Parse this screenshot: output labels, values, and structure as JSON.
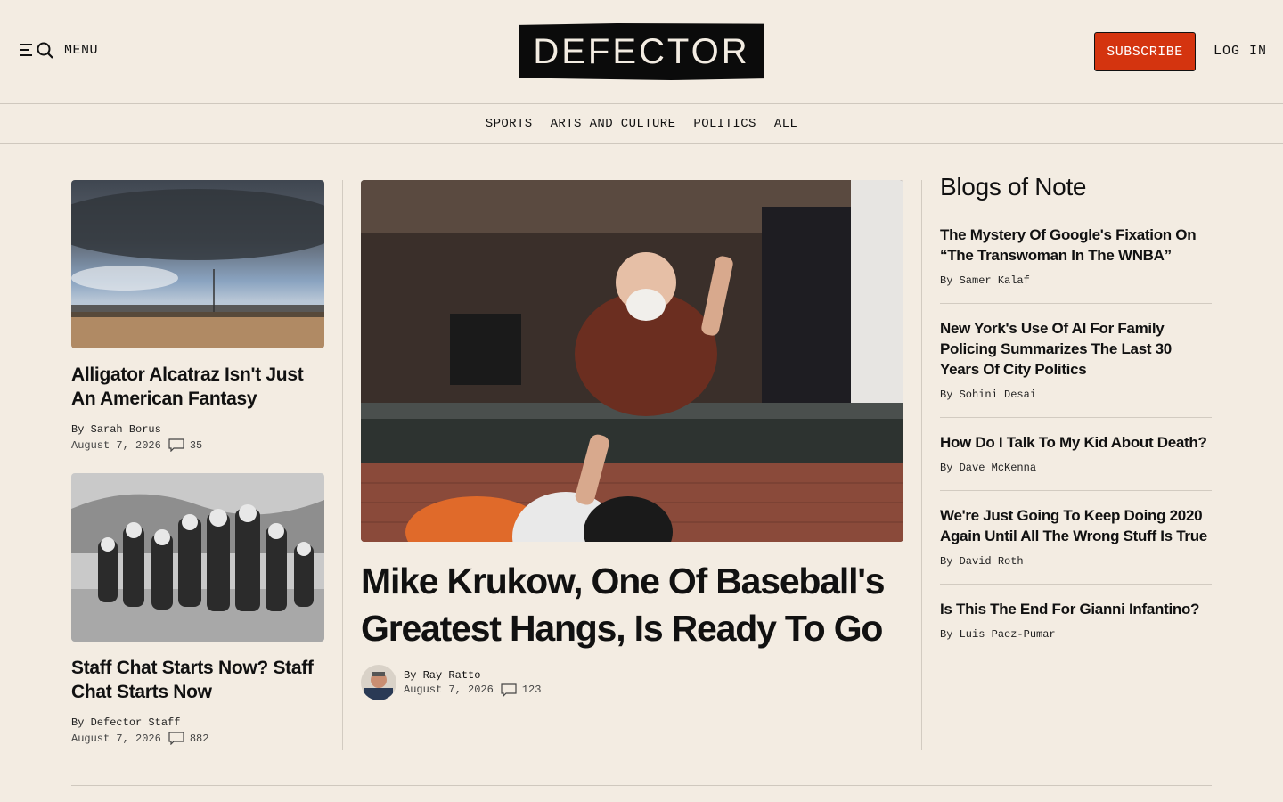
{
  "header": {
    "menu_label": "MENU",
    "logo_text": "DEFECTOR",
    "subscribe_label": "SUBSCRIBE",
    "login_label": "LOG IN"
  },
  "nav": {
    "items": [
      "SPORTS",
      "ARTS AND CULTURE",
      "POLITICS",
      "ALL"
    ]
  },
  "left_articles": [
    {
      "title": "Alligator Alcatraz Isn't Just An American Fantasy",
      "author": "Sarah Borus",
      "date": "August 7, 2026",
      "comments": "35"
    },
    {
      "title": "Staff Chat Starts Now? Staff Chat Starts Now",
      "author": "Defector Staff",
      "date": "August 7, 2026",
      "comments": "882"
    }
  ],
  "by_prefix": "By",
  "hero": {
    "title": "Mike Krukow, One Of Baseball's Greatest Hangs, Is Ready To Go",
    "author": "Ray Ratto",
    "date": "August 7, 2026",
    "comments": "123"
  },
  "sidebar": {
    "heading": "Blogs of Note",
    "items": [
      {
        "title": "The Mystery Of Google's Fixation On “The Transwoman In The WNBA”",
        "author": "Samer Kalaf"
      },
      {
        "title": "New York's Use Of AI For Family Policing Summarizes The Last 30 Years Of City Politics",
        "author": "Sohini Desai"
      },
      {
        "title": "How Do I Talk To My Kid About Death?",
        "author": "Dave McKenna"
      },
      {
        "title": "We're Just Going To Keep Doing 2020 Again Until All The Wrong Stuff Is True",
        "author": "David Roth"
      },
      {
        "title": "Is This The End For Gianni Infantino?",
        "author": "Luis Paez-Pumar"
      }
    ]
  },
  "colors": {
    "background": "#f3ece2",
    "subscribe": "#d4340f",
    "logo": "#0b0b0b"
  }
}
